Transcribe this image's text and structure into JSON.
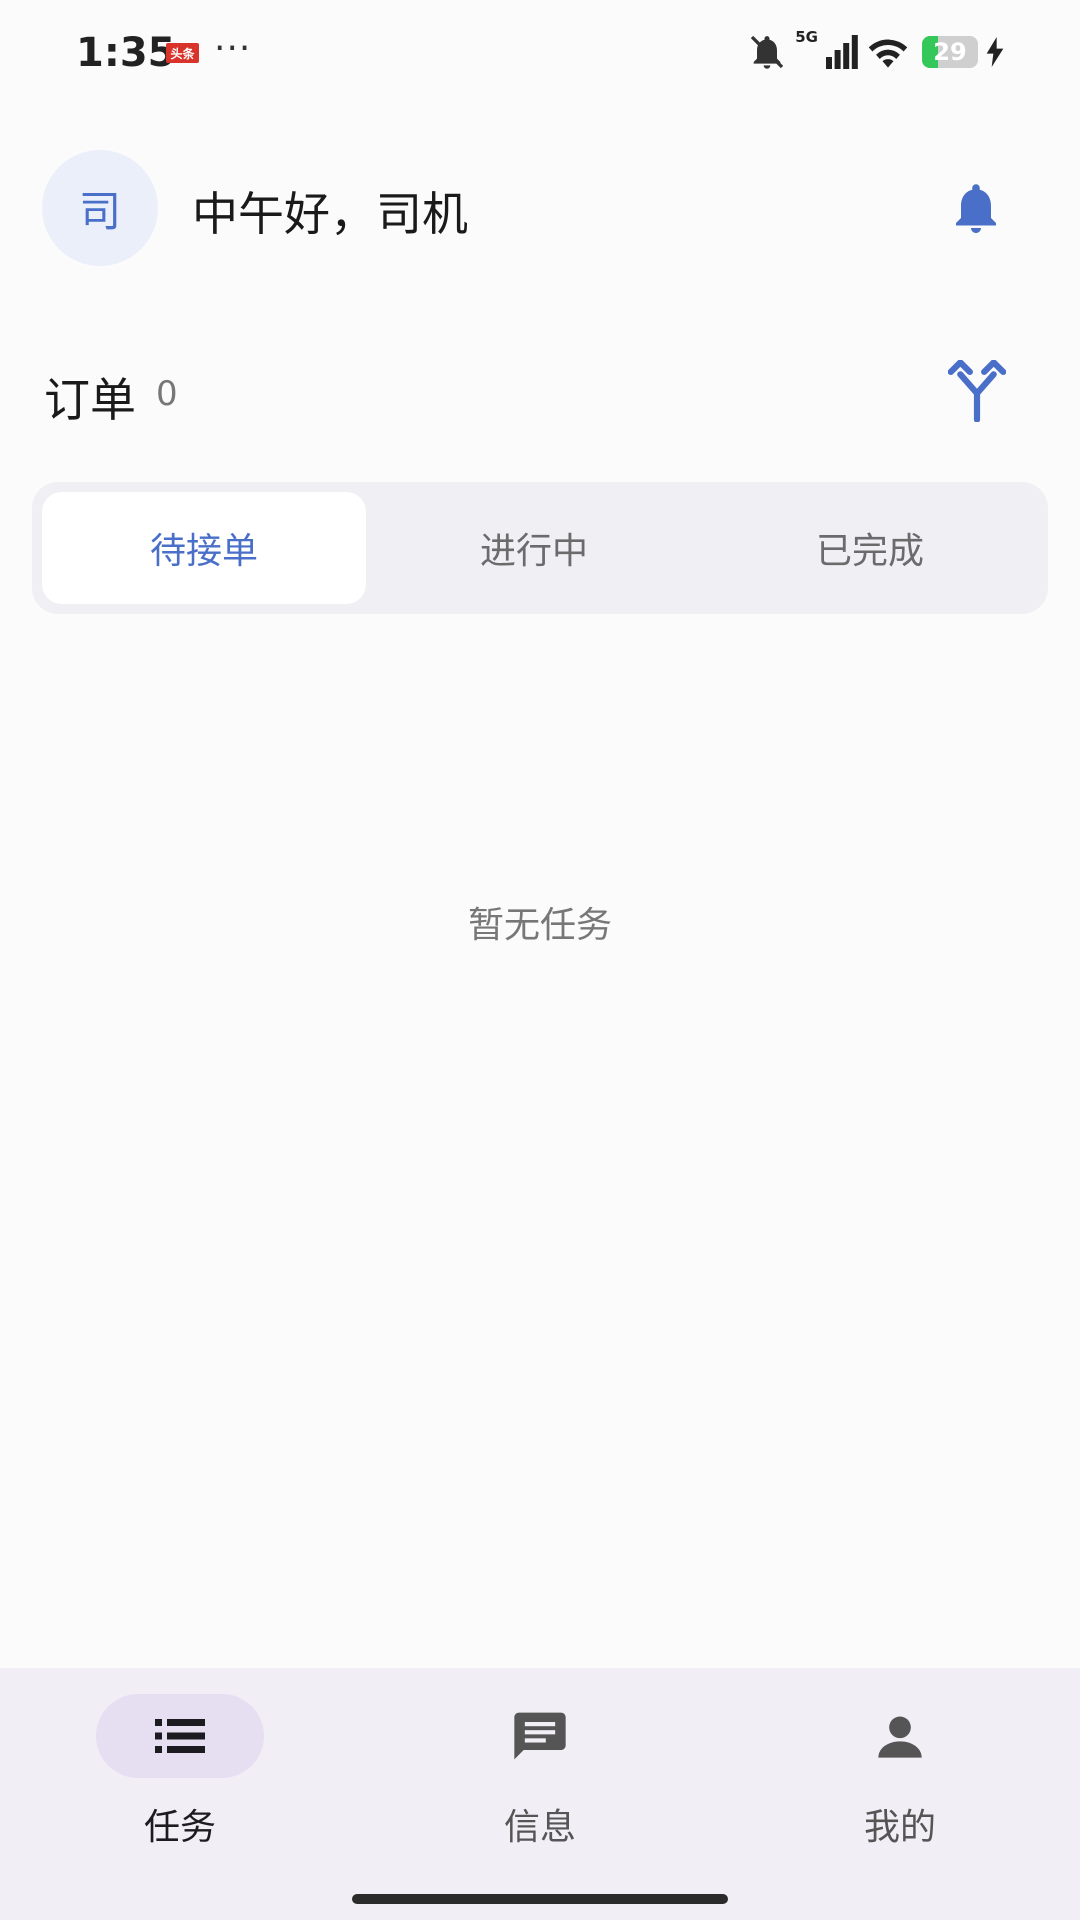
{
  "status_bar": {
    "time": "1:35",
    "app_badge": "头条",
    "more": "···",
    "network": "5G",
    "battery_level": "29",
    "battery_fraction": 0.29,
    "icons": [
      "bell-off-icon",
      "signal-icon",
      "wifi-icon",
      "battery-icon",
      "charging-bolt-icon"
    ]
  },
  "header": {
    "avatar_text": "司",
    "greeting": "中午好，司机",
    "bell_icon": "bell-icon"
  },
  "orders": {
    "title": "订单",
    "count": "0",
    "sort_icon": "merge-arrows-icon"
  },
  "tabs": [
    {
      "label": "待接单",
      "active": true
    },
    {
      "label": "进行中",
      "active": false
    },
    {
      "label": "已完成",
      "active": false
    }
  ],
  "empty_state": {
    "text": "暂无任务"
  },
  "bottom_nav": [
    {
      "label": "任务",
      "icon": "list-icon",
      "active": true
    },
    {
      "label": "信息",
      "icon": "message-icon",
      "active": false
    },
    {
      "label": "我的",
      "icon": "person-icon",
      "active": false
    }
  ],
  "colors": {
    "accent": "#4a6fc9",
    "background": "#fcfbfc",
    "nav_background": "#f2eef6",
    "nav_active_pill": "#e5dff1",
    "battery_green": "#34c759"
  }
}
